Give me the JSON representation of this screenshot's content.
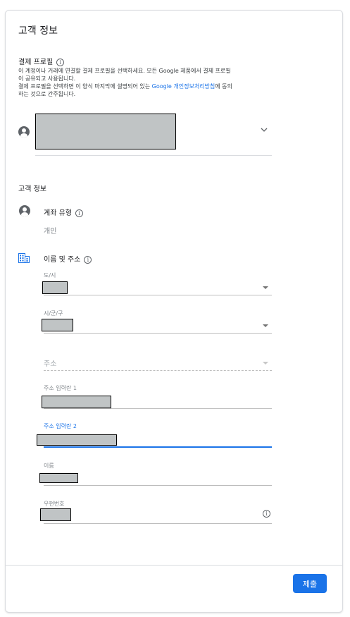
{
  "title": "고객 정보",
  "payment_profile": {
    "label": "결제 프로필",
    "desc_line1": "이 계정이나 거래에 연결할 결제 프로필을 선택하세요. 모든 Google 제품에서 결제 프로필",
    "desc_line2": "이 공유되고 사용됩니다.",
    "desc_line3_prefix": "결제 프로필을 선택하면 이 양식 마지막에 설명되어 있는 ",
    "desc_link": "Google 개인정보처리방침",
    "desc_line3_suffix": "에 동의",
    "desc_line4": "하는 것으로 간주됩니다."
  },
  "customer_info": {
    "heading": "고객 정보",
    "account_type_label": "계좌 유형",
    "account_type_value": "개인",
    "name_address_label": "이름 및 주소"
  },
  "fields": {
    "city_label": "도/시",
    "district_label": "시/군/구",
    "address_placeholder": "주소",
    "address1_label": "주소 입력란 1",
    "address2_label": "주소 입력란 2",
    "name_label": "이름",
    "postal_label": "우편번호"
  },
  "icons": {
    "info": "info-icon",
    "account": "account-circle-icon",
    "building": "building-icon",
    "dropdown": "chevron-down-icon"
  },
  "colors": {
    "accent": "#1a73e8",
    "redaction": "#c0c4c5"
  },
  "submit_label": "제출"
}
